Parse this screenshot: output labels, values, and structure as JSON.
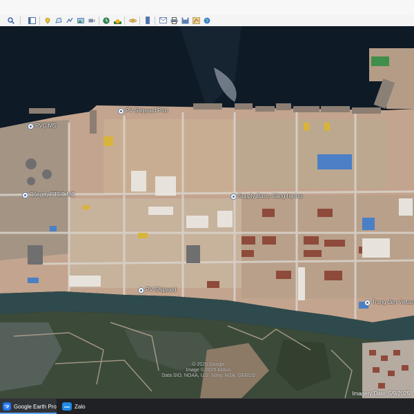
{
  "app": {
    "title": "Google Earth Pro"
  },
  "toolbar": {
    "icons": [
      "search-icon",
      "sidebar-toggle-icon",
      "placemark-icon",
      "polygon-icon",
      "path-icon",
      "image-overlay-icon",
      "record-tour-icon",
      "historical-imagery-icon",
      "sun-icon",
      "planets-icon",
      "ruler-icon",
      "email-icon",
      "print-icon",
      "save-image-icon",
      "map-view-icon",
      "globe-icon"
    ]
  },
  "map": {
    "places": [
      {
        "label": "PVC MS"
      },
      {
        "label": "PV Shipyard Port"
      },
      {
        "label": "Công ty PTSC MC"
      },
      {
        "label": "Supply Base, Cảng hạ lưu"
      },
      {
        "label": "PV Shipyard"
      },
      {
        "label": "Trung tâm Vietsovpetro"
      }
    ],
    "attribution": {
      "copyright": "© 2025 Google",
      "image": "Image © 2025 Airbus",
      "data": "Data SIO, NOAA, U.S. Navy, NGA, GEBCO"
    },
    "imagery_date": "Imagery Date: 5/9/2025"
  },
  "taskbar": {
    "items": [
      {
        "label": "Google Earth Pro",
        "icon": "google-earth-icon"
      },
      {
        "label": "Zalo",
        "icon": "zalo-icon",
        "badge": "Zalo"
      }
    ]
  },
  "colors": {
    "sea": "#0e1a26",
    "land": "#c3a48e",
    "wetland": "#3c4a3a",
    "river": "#2f4a4c",
    "taskbar": "#202124"
  }
}
